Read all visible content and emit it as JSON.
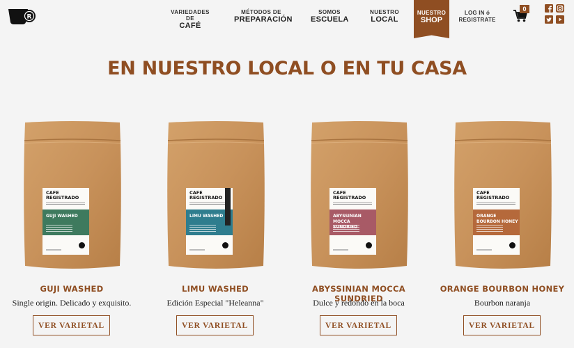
{
  "header": {
    "logo_name": "Café Registrado",
    "nav": [
      {
        "small": "VARIEDADES DE",
        "big": "CAFÉ"
      },
      {
        "small": "MÉTODOS DE",
        "big": "PREPARACIÓN"
      },
      {
        "small": "SOMOS",
        "big": "ESCUELA"
      },
      {
        "small": "NUESTRO",
        "big": "LOCAL"
      }
    ],
    "shop": {
      "small": "NUESTRO",
      "big": "SHOP"
    },
    "login_line1": "LOG IN ó",
    "login_line2": "REGISTRATE",
    "cart_count": "0",
    "accent_color": "#8f4e22"
  },
  "title": "EN NUESTRO LOCAL O EN TU CASA",
  "products": [
    {
      "name": "GUJI WASHED",
      "description": "Single origin. Delicado y exquisito.",
      "button": "VER VARIETAL",
      "label_brand": "CAFE REGISTRADO",
      "label_name": "GUJI WASHED",
      "label_color": "#3e7a5e"
    },
    {
      "name": "LIMU WASHED",
      "description": "Edición Especial \"Heleanna\"",
      "button": "VER VARIETAL",
      "label_brand": "CAFE REGISTRADO",
      "label_name": "LIMU WASHED",
      "label_color": "#2f7d8e"
    },
    {
      "name": "ABYSSINIAN MOCCA SUNDRIED",
      "description": "Dulce y redondo en la boca",
      "button": "VER VARIETAL",
      "label_brand": "CAFE REGISTRADO",
      "label_name": "ABYSSINIAN MOCCA SUNDRIED",
      "label_color": "#a85a66"
    },
    {
      "name": "ORANGE BOURBON HONEY",
      "description": "Bourbon naranja",
      "button": "VER VARIETAL",
      "label_brand": "CAFE REGISTRADO",
      "label_name": "ORANGE BOURBON HONEY",
      "label_color": "#b5693b"
    }
  ]
}
